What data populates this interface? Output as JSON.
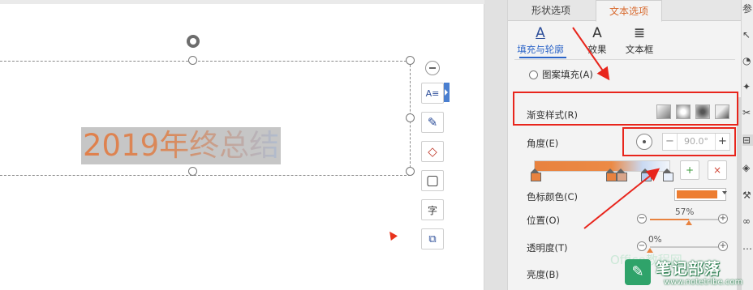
{
  "slide": {
    "title": "2019年终总结"
  },
  "quick_toolbar": {
    "items": [
      {
        "name": "text-style-icon",
        "glyph": "A≡"
      },
      {
        "name": "pen-icon",
        "glyph": "✎"
      },
      {
        "name": "fill-icon",
        "glyph": "◇"
      },
      {
        "name": "outline-icon",
        "glyph": "▢"
      },
      {
        "name": "char-spacing-icon",
        "glyph": "字"
      },
      {
        "name": "arrange-icon",
        "glyph": "⧉"
      }
    ]
  },
  "panel": {
    "tabs": {
      "shape_options": "形状选项",
      "text_options": "文本选项"
    },
    "subtabs": {
      "fill_outline": "填充与轮廓",
      "effect": "效果",
      "textbox": "文本框",
      "fill_outline_icon": "A",
      "effect_icon": "A",
      "textbox_icon": "≣"
    },
    "pattern_fill": "图案填充(A)",
    "gradient_style": "渐变样式(R)",
    "angle": {
      "label": "角度(E)",
      "value": "90.0°",
      "minus": "−",
      "plus": "+"
    },
    "gradient_stops": {
      "add": "+",
      "remove": "×"
    },
    "stop_color": {
      "label": "色标颜色(C)",
      "color": "#ED7D31"
    },
    "position": {
      "label": "位置(O)",
      "value": "57%",
      "fraction": 0.57
    },
    "transparency": {
      "label": "透明度(T)",
      "value": "0%",
      "fraction": 0.0
    },
    "brightness": {
      "label": "亮度(B)"
    }
  },
  "side_rail": {
    "labels": [
      "参"
    ]
  },
  "watermark": {
    "logo": "✎",
    "name": "笔记部落",
    "site": "www.notetribe.com",
    "ghost": "Office教程网"
  },
  "colors": {
    "accent_orange": "#D86A2E",
    "accent_blue": "#2B64C8",
    "highlight_red": "#E8251C",
    "watermark_green": "#2FA36A"
  }
}
